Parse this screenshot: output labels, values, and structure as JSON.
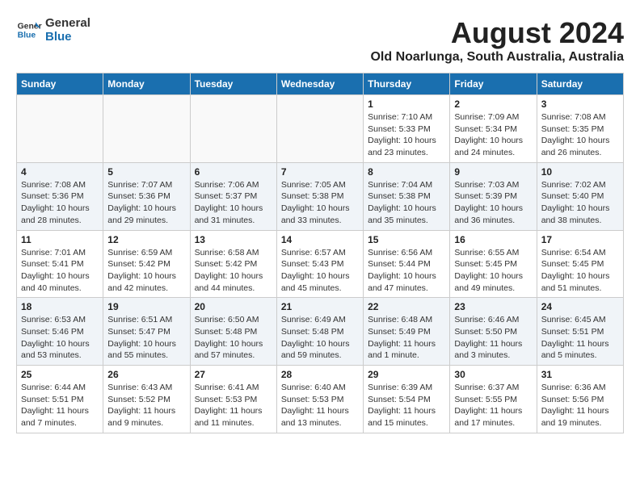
{
  "header": {
    "logo_line1": "General",
    "logo_line2": "Blue",
    "main_title": "August 2024",
    "subtitle": "Old Noarlunga, South Australia, Australia"
  },
  "weekdays": [
    "Sunday",
    "Monday",
    "Tuesday",
    "Wednesday",
    "Thursday",
    "Friday",
    "Saturday"
  ],
  "weeks": [
    [
      {
        "day": "",
        "info": ""
      },
      {
        "day": "",
        "info": ""
      },
      {
        "day": "",
        "info": ""
      },
      {
        "day": "",
        "info": ""
      },
      {
        "day": "1",
        "info": "Sunrise: 7:10 AM\nSunset: 5:33 PM\nDaylight: 10 hours\nand 23 minutes."
      },
      {
        "day": "2",
        "info": "Sunrise: 7:09 AM\nSunset: 5:34 PM\nDaylight: 10 hours\nand 24 minutes."
      },
      {
        "day": "3",
        "info": "Sunrise: 7:08 AM\nSunset: 5:35 PM\nDaylight: 10 hours\nand 26 minutes."
      }
    ],
    [
      {
        "day": "4",
        "info": "Sunrise: 7:08 AM\nSunset: 5:36 PM\nDaylight: 10 hours\nand 28 minutes."
      },
      {
        "day": "5",
        "info": "Sunrise: 7:07 AM\nSunset: 5:36 PM\nDaylight: 10 hours\nand 29 minutes."
      },
      {
        "day": "6",
        "info": "Sunrise: 7:06 AM\nSunset: 5:37 PM\nDaylight: 10 hours\nand 31 minutes."
      },
      {
        "day": "7",
        "info": "Sunrise: 7:05 AM\nSunset: 5:38 PM\nDaylight: 10 hours\nand 33 minutes."
      },
      {
        "day": "8",
        "info": "Sunrise: 7:04 AM\nSunset: 5:38 PM\nDaylight: 10 hours\nand 35 minutes."
      },
      {
        "day": "9",
        "info": "Sunrise: 7:03 AM\nSunset: 5:39 PM\nDaylight: 10 hours\nand 36 minutes."
      },
      {
        "day": "10",
        "info": "Sunrise: 7:02 AM\nSunset: 5:40 PM\nDaylight: 10 hours\nand 38 minutes."
      }
    ],
    [
      {
        "day": "11",
        "info": "Sunrise: 7:01 AM\nSunset: 5:41 PM\nDaylight: 10 hours\nand 40 minutes."
      },
      {
        "day": "12",
        "info": "Sunrise: 6:59 AM\nSunset: 5:42 PM\nDaylight: 10 hours\nand 42 minutes."
      },
      {
        "day": "13",
        "info": "Sunrise: 6:58 AM\nSunset: 5:42 PM\nDaylight: 10 hours\nand 44 minutes."
      },
      {
        "day": "14",
        "info": "Sunrise: 6:57 AM\nSunset: 5:43 PM\nDaylight: 10 hours\nand 45 minutes."
      },
      {
        "day": "15",
        "info": "Sunrise: 6:56 AM\nSunset: 5:44 PM\nDaylight: 10 hours\nand 47 minutes."
      },
      {
        "day": "16",
        "info": "Sunrise: 6:55 AM\nSunset: 5:45 PM\nDaylight: 10 hours\nand 49 minutes."
      },
      {
        "day": "17",
        "info": "Sunrise: 6:54 AM\nSunset: 5:45 PM\nDaylight: 10 hours\nand 51 minutes."
      }
    ],
    [
      {
        "day": "18",
        "info": "Sunrise: 6:53 AM\nSunset: 5:46 PM\nDaylight: 10 hours\nand 53 minutes."
      },
      {
        "day": "19",
        "info": "Sunrise: 6:51 AM\nSunset: 5:47 PM\nDaylight: 10 hours\nand 55 minutes."
      },
      {
        "day": "20",
        "info": "Sunrise: 6:50 AM\nSunset: 5:48 PM\nDaylight: 10 hours\nand 57 minutes."
      },
      {
        "day": "21",
        "info": "Sunrise: 6:49 AM\nSunset: 5:48 PM\nDaylight: 10 hours\nand 59 minutes."
      },
      {
        "day": "22",
        "info": "Sunrise: 6:48 AM\nSunset: 5:49 PM\nDaylight: 11 hours\nand 1 minute."
      },
      {
        "day": "23",
        "info": "Sunrise: 6:46 AM\nSunset: 5:50 PM\nDaylight: 11 hours\nand 3 minutes."
      },
      {
        "day": "24",
        "info": "Sunrise: 6:45 AM\nSunset: 5:51 PM\nDaylight: 11 hours\nand 5 minutes."
      }
    ],
    [
      {
        "day": "25",
        "info": "Sunrise: 6:44 AM\nSunset: 5:51 PM\nDaylight: 11 hours\nand 7 minutes."
      },
      {
        "day": "26",
        "info": "Sunrise: 6:43 AM\nSunset: 5:52 PM\nDaylight: 11 hours\nand 9 minutes."
      },
      {
        "day": "27",
        "info": "Sunrise: 6:41 AM\nSunset: 5:53 PM\nDaylight: 11 hours\nand 11 minutes."
      },
      {
        "day": "28",
        "info": "Sunrise: 6:40 AM\nSunset: 5:53 PM\nDaylight: 11 hours\nand 13 minutes."
      },
      {
        "day": "29",
        "info": "Sunrise: 6:39 AM\nSunset: 5:54 PM\nDaylight: 11 hours\nand 15 minutes."
      },
      {
        "day": "30",
        "info": "Sunrise: 6:37 AM\nSunset: 5:55 PM\nDaylight: 11 hours\nand 17 minutes."
      },
      {
        "day": "31",
        "info": "Sunrise: 6:36 AM\nSunset: 5:56 PM\nDaylight: 11 hours\nand 19 minutes."
      }
    ]
  ]
}
